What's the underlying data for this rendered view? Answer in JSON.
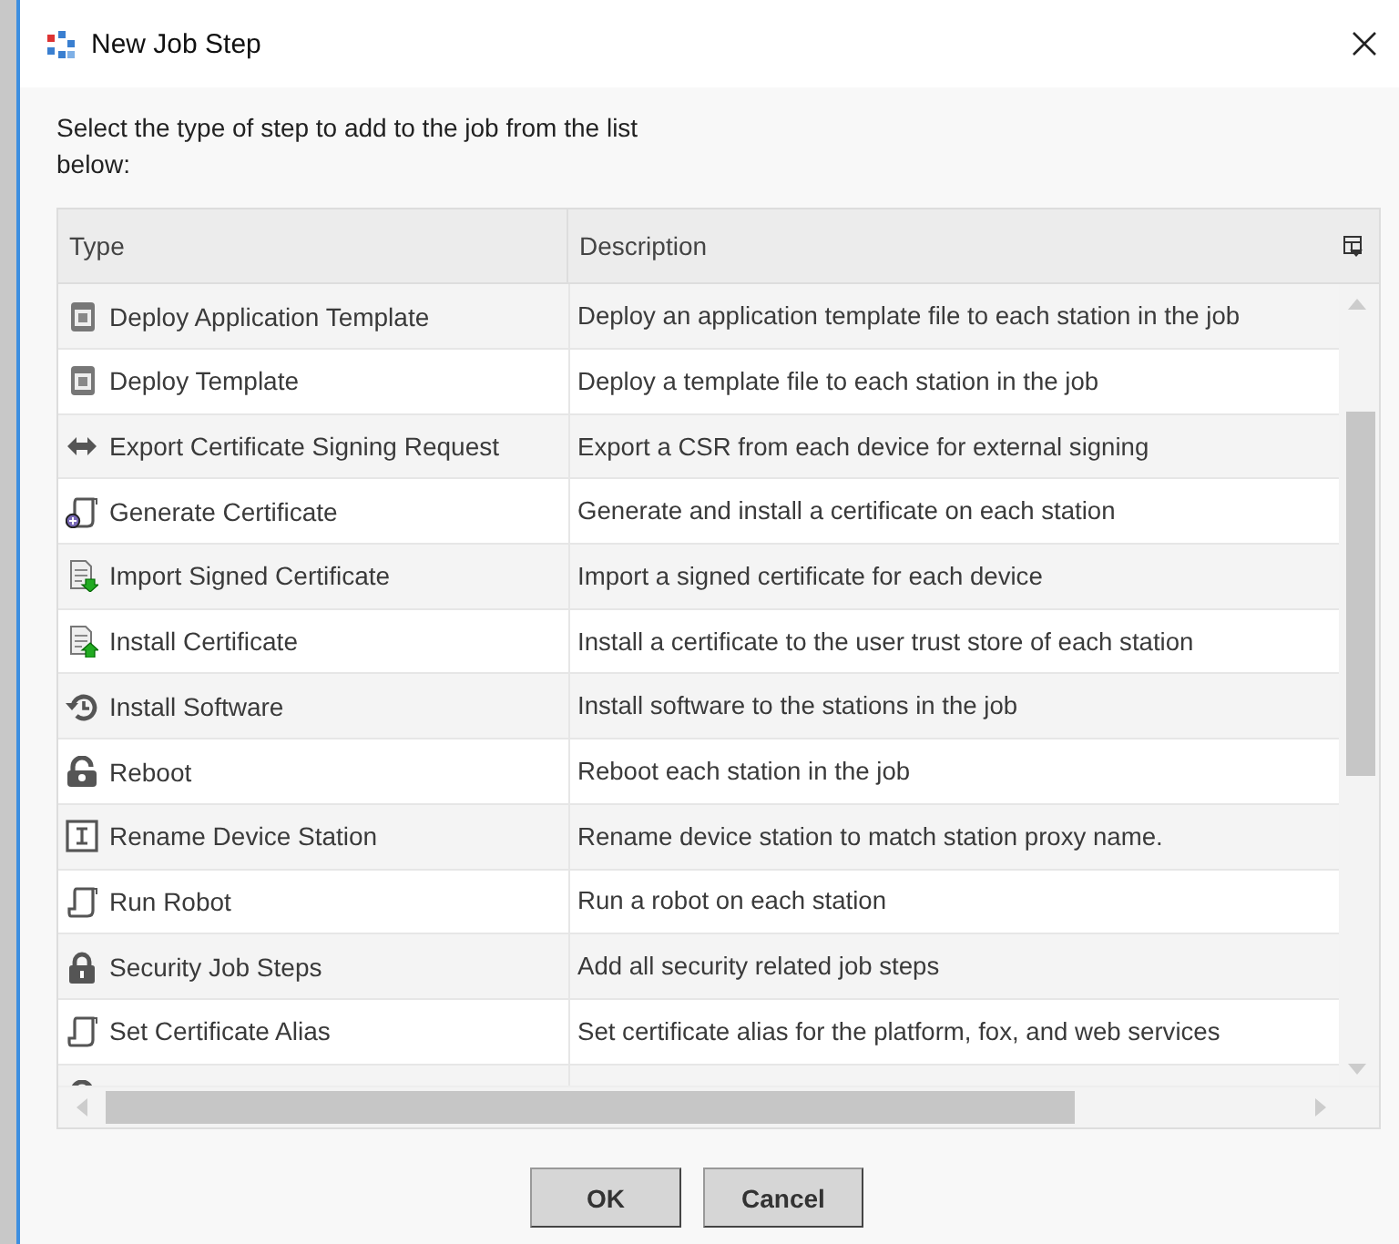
{
  "window": {
    "title": "New Job Step"
  },
  "instruction": "Select the type of step to add to the job from the list below:",
  "table": {
    "columns": [
      "Type",
      "Description"
    ],
    "rows": [
      {
        "kind": "template",
        "type": "Deploy Application Template",
        "description": "Deploy an application template file to each station in the job"
      },
      {
        "kind": "template",
        "type": "Deploy Template",
        "description": "Deploy a template file to each station in the job"
      },
      {
        "kind": "exchange",
        "type": "Export Certificate Signing Request",
        "description": "Export a CSR from each device for external signing"
      },
      {
        "kind": "generate",
        "type": "Generate Certificate",
        "description": "Generate and install a certificate on each station"
      },
      {
        "kind": "import",
        "type": "Import Signed Certificate",
        "description": "Import a signed certificate for each device"
      },
      {
        "kind": "install",
        "type": "Install Certificate",
        "description": "Install a certificate to the user trust store of each station"
      },
      {
        "kind": "history",
        "type": "Install Software",
        "description": "Install software to the stations in the job"
      },
      {
        "kind": "reboot",
        "type": "Reboot",
        "description": "Reboot each station in the job"
      },
      {
        "kind": "rename",
        "type": "Rename Device Station",
        "description": "Rename device station to match station proxy name."
      },
      {
        "kind": "scroll",
        "type": "Run Robot",
        "description": "Run a robot on each station"
      },
      {
        "kind": "lock",
        "type": "Security Job Steps",
        "description": "Add all security related job steps"
      },
      {
        "kind": "scroll",
        "type": "Set Certificate Alias",
        "description": "Set certificate alias for the platform, fox, and web services"
      },
      {
        "kind": "reboot"
      }
    ]
  },
  "buttons": [
    "OK",
    "Cancel"
  ]
}
